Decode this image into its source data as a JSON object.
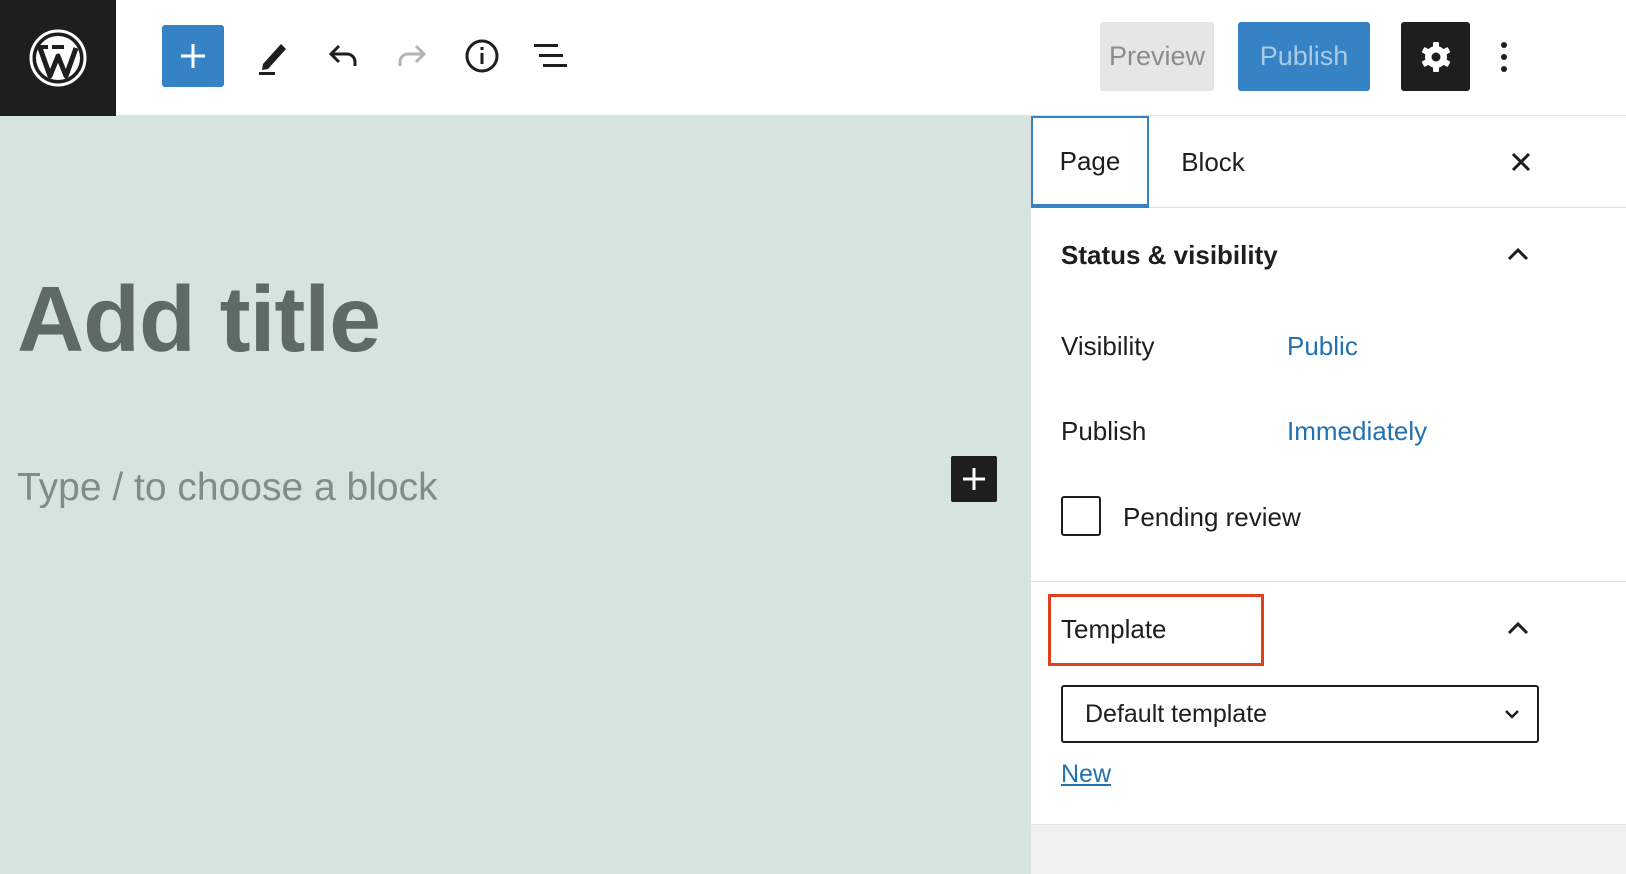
{
  "toolbar": {
    "logo_icon": "wordpress-logo-icon",
    "add_block_icon": "plus-icon",
    "tools_icon": "pencil-icon",
    "undo_icon": "undo-icon",
    "redo_icon": "redo-icon",
    "details_icon": "info-icon",
    "list_view_icon": "list-view-icon",
    "preview_label": "Preview",
    "publish_label": "Publish",
    "settings_icon": "gear-icon",
    "more_icon": "more-vertical-icon",
    "accent_color": "#3582c4"
  },
  "editor": {
    "title_placeholder": "Add title",
    "block_placeholder": "Type / to choose a block",
    "canvas_color": "#d5e4de"
  },
  "sidebar": {
    "tabs": [
      {
        "label": "Page",
        "active": true
      },
      {
        "label": "Block",
        "active": false
      }
    ],
    "close_icon": "close-icon",
    "status_panel": {
      "title": "Status & visibility",
      "rows": [
        {
          "label": "Visibility",
          "value": "Public"
        },
        {
          "label": "Publish",
          "value": "Immediately"
        }
      ],
      "pending_review_label": "Pending review",
      "pending_review_checked": false
    },
    "template_panel": {
      "title": "Template",
      "select_value": "Default template",
      "new_link": "New",
      "highlight_color": "#e2401c"
    }
  }
}
